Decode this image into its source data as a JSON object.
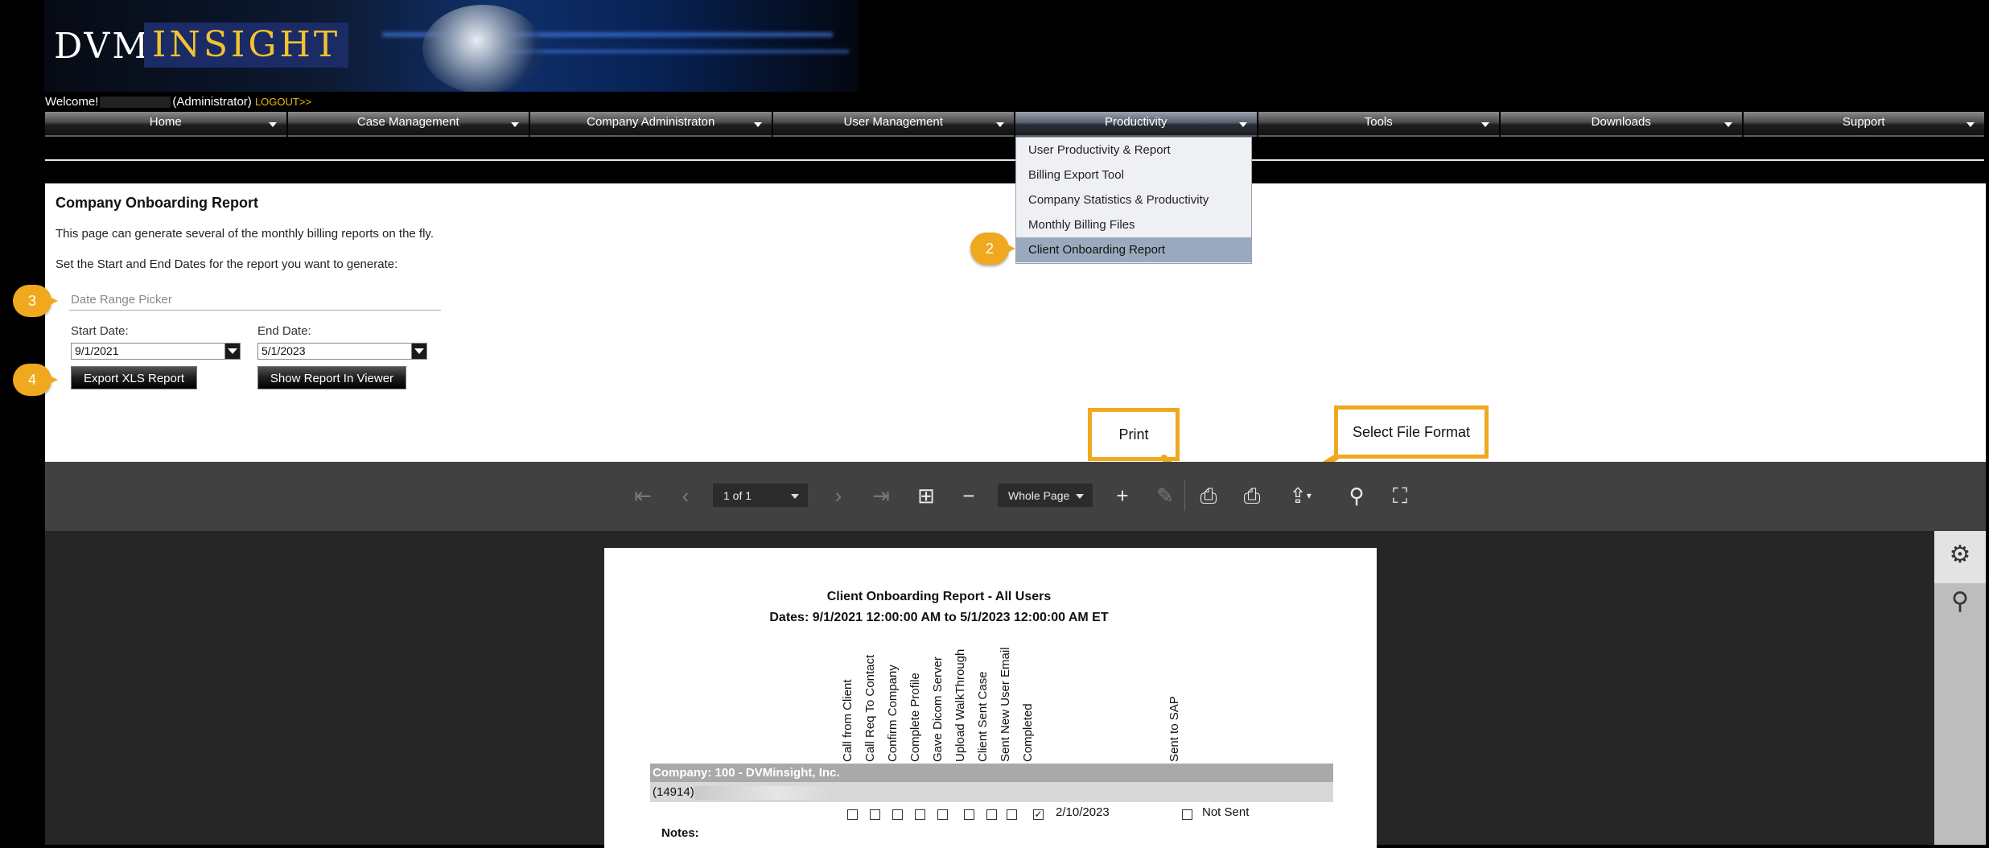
{
  "banner": {
    "logo_dvm": "DVM",
    "logo_insight": "INSIGHT"
  },
  "welcome": {
    "prefix": "Welcome!",
    "role": "(Administrator)",
    "logout": "LOGOUT>>"
  },
  "nav": {
    "items": [
      "Home",
      "Case Management",
      "Company Administraton",
      "User Management",
      "Productivity",
      "Tools",
      "Downloads",
      "Support"
    ],
    "active": "Productivity"
  },
  "productivity_menu": {
    "items": [
      "User Productivity & Report",
      "Billing Export Tool",
      "Company Statistics & Productivity",
      "Monthly Billing Files",
      "Client Onboarding Report"
    ],
    "selected": "Client Onboarding Report"
  },
  "page": {
    "title": "Company Onboarding Report",
    "desc1": "This page can generate several of the monthly billing reports on the fly.",
    "desc2": "Set the Start and End Dates for the report you want to generate:",
    "date_range_label": "Date Range Picker",
    "start_label": "Start Date:",
    "start_value": "9/1/2021",
    "end_label": "End Date:",
    "end_value": "5/1/2023",
    "export_btn": "Export XLS Report",
    "viewer_btn": "Show Report In Viewer"
  },
  "callouts": {
    "step2": "2",
    "step3": "3",
    "step4": "4",
    "print": "Print",
    "file_format": "Select File Format"
  },
  "toolbar": {
    "page_select": "1 of 1",
    "zoom_select": "Whole Page",
    "icons": [
      "first-page-icon",
      "prev-page-icon",
      "next-page-icon",
      "last-page-icon",
      "multipage-icon",
      "zoom-out-icon",
      "zoom-in-icon",
      "edit-icon",
      "print-icon",
      "print-page-icon",
      "export-icon",
      "search-icon",
      "fullscreen-icon"
    ]
  },
  "side_panel": {
    "icons": [
      "gear-icon",
      "search-icon"
    ]
  },
  "report": {
    "title": "Client Onboarding Report - All Users",
    "dates": "Dates: 9/1/2021 12:00:00 AM to 5/1/2023 12:00:00 AM ET",
    "columns": [
      "Call from Client",
      "Call Req To Contact",
      "Confirm Company",
      "Complete Profile",
      "Gave Dicom Server",
      "Upload WalkThrough",
      "Client Sent Case",
      "Sent New User Email",
      "Completed",
      "Sent to SAP"
    ],
    "company_row": "Company: 100 - DVMinsight, Inc.",
    "user_id": "(14914)",
    "completed_date": "2/10/2023",
    "sap_status": "Not Sent",
    "notes_label": "Notes:"
  },
  "colors": {
    "accent": "#f0a81e",
    "gold_text": "#f2b90f",
    "toolbar": "#414141",
    "viewer_bg": "#262626"
  }
}
